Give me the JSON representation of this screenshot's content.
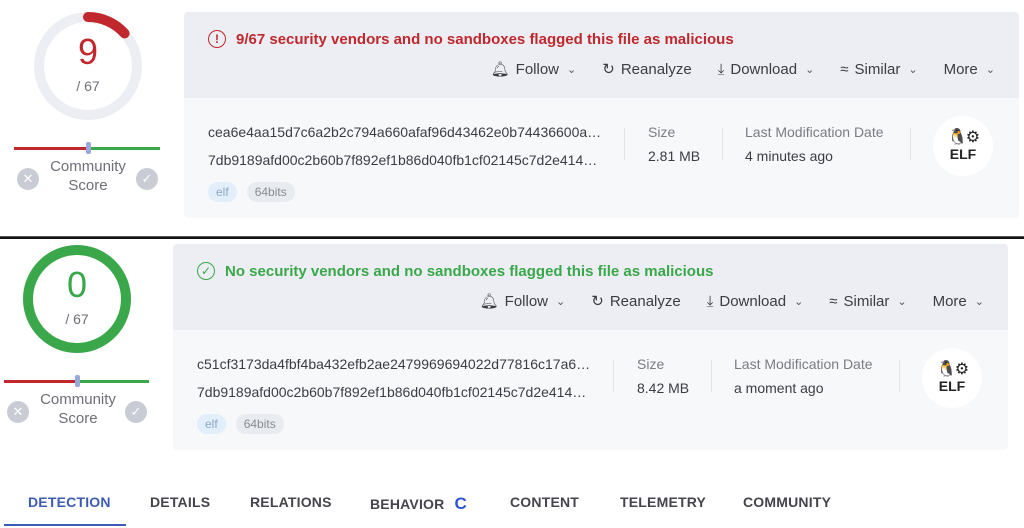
{
  "reports": [
    {
      "detections": "9",
      "total": "/ 67",
      "detection_ratio": 0.134,
      "status": "malicious",
      "ring_color": "#c0282d",
      "alert_icon": "exclamation-circle-icon",
      "alert_glyph": "!",
      "alert_text": "9/67 security vendors and no sandboxes flagged this file as malicious",
      "community_score_label": "Community Score",
      "community_score_position": 0.5,
      "vote_down_glyph": "✕",
      "vote_up_glyph": "✓",
      "actions": [
        {
          "icon": "bell-icon",
          "glyph": "🔔︎",
          "label": "Follow",
          "dropdown": true
        },
        {
          "icon": "reanalyze-icon",
          "glyph": "↻",
          "label": "Reanalyze",
          "dropdown": false
        },
        {
          "icon": "download-icon",
          "glyph": "⤓",
          "label": "Download",
          "dropdown": true
        },
        {
          "icon": "similar-icon",
          "glyph": "≈",
          "label": "Similar",
          "dropdown": true
        },
        {
          "icon": "more-icon",
          "glyph": "",
          "label": "More",
          "dropdown": true
        }
      ],
      "chevron_glyph": "⌄",
      "hash_1": "cea6e4aa15d7c6a2b2c794a660afaf96d43462e0b74436600a…",
      "hash_2": "7db9189afd00c2b60b7f892ef1b86d040fb1cf02145c7d2e414…",
      "tags": [
        "elf",
        "64bits"
      ],
      "size_label": "Size",
      "size_value": "2.81 MB",
      "date_label": "Last Modification Date",
      "date_value": "4 minutes ago",
      "file_type": "ELF",
      "file_type_icons": "🐧⚙"
    },
    {
      "detections": "0",
      "total": "/ 67",
      "detection_ratio": 0,
      "status": "clean",
      "ring_color": "#3aa84a",
      "alert_icon": "check-circle-icon",
      "alert_glyph": "✓",
      "alert_text": "No security vendors and no sandboxes flagged this file as malicious",
      "community_score_label": "Community Score",
      "community_score_position": 0.5,
      "vote_down_glyph": "✕",
      "vote_up_glyph": "✓",
      "actions": [
        {
          "icon": "bell-icon",
          "glyph": "🔔︎",
          "label": "Follow",
          "dropdown": true
        },
        {
          "icon": "reanalyze-icon",
          "glyph": "↻",
          "label": "Reanalyze",
          "dropdown": false
        },
        {
          "icon": "download-icon",
          "glyph": "⤓",
          "label": "Download",
          "dropdown": true
        },
        {
          "icon": "similar-icon",
          "glyph": "≈",
          "label": "Similar",
          "dropdown": true
        },
        {
          "icon": "more-icon",
          "glyph": "",
          "label": "More",
          "dropdown": true
        }
      ],
      "chevron_glyph": "⌄",
      "hash_1": "c51cf3173da4fbf4ba432efb2ae2479969694022d77816c17a6…",
      "hash_2": "7db9189afd00c2b60b7f892ef1b86d040fb1cf02145c7d2e414…",
      "tags": [
        "elf",
        "64bits"
      ],
      "size_label": "Size",
      "size_value": "8.42 MB",
      "date_label": "Last Modification Date",
      "date_value": "a moment ago",
      "file_type": "ELF",
      "file_type_icons": "🐧⚙"
    }
  ],
  "tabs": [
    {
      "label": "DETECTION",
      "active": true
    },
    {
      "label": "DETAILS",
      "active": false
    },
    {
      "label": "RELATIONS",
      "active": false
    },
    {
      "label": "BEHAVIOR",
      "active": false,
      "loading": true
    },
    {
      "label": "CONTENT",
      "active": false
    },
    {
      "label": "TELEMETRY",
      "active": false
    },
    {
      "label": "COMMUNITY",
      "active": false
    }
  ],
  "spinner_glyph": "C",
  "colors": {
    "malicious": "#c0282d",
    "clean": "#3aa84a",
    "accent": "#3b5bb5",
    "ring_track": "#eceef3"
  }
}
